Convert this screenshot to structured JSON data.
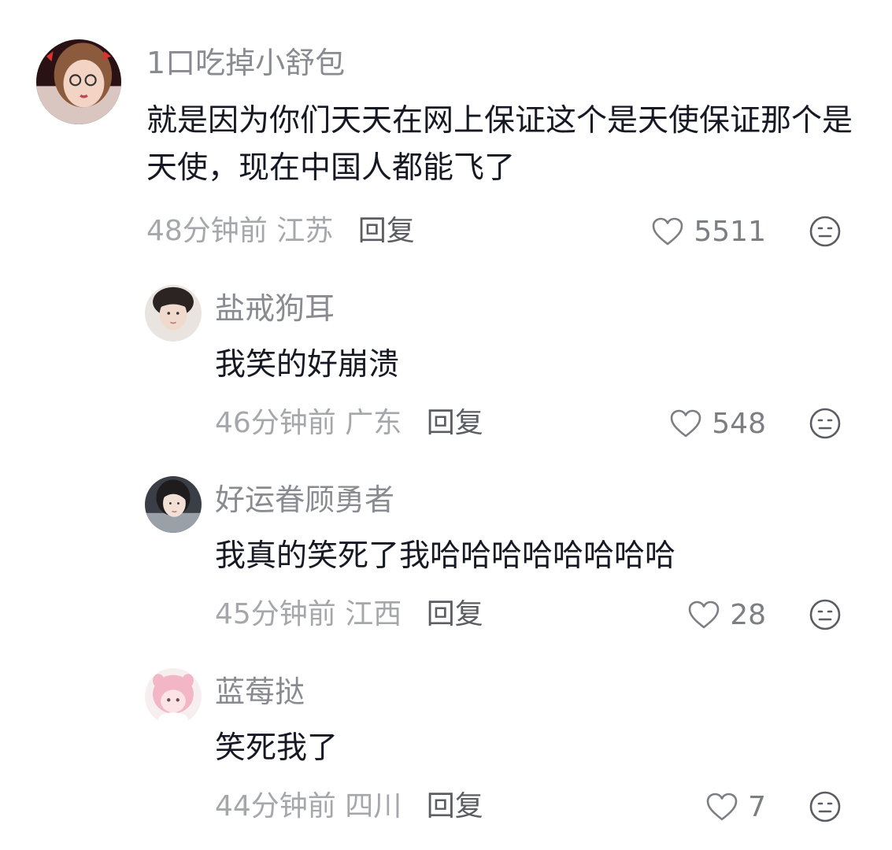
{
  "comment": {
    "username": "1口吃掉小舒包",
    "text": "就是因为你们天天在网上保证这个是天使保证那个是天使，现在中国人都能飞了",
    "time": "48分钟前",
    "location": "江苏",
    "reply_label": "回复",
    "likes": "5511",
    "avatar_icon": "avatar-photo"
  },
  "replies": [
    {
      "username": "盐戒狗耳",
      "text": "我笑的好崩溃",
      "time": "46分钟前",
      "location": "广东",
      "reply_label": "回复",
      "likes": "548",
      "avatar_icon": "avatar-photo"
    },
    {
      "username": "好运眷顾勇者",
      "text": "我真的笑死了我哈哈哈哈哈哈哈哈",
      "time": "45分钟前",
      "location": "江西",
      "reply_label": "回复",
      "likes": "28",
      "avatar_icon": "avatar-photo"
    },
    {
      "username": "蓝莓挞",
      "text": "笑死我了",
      "time": "44分钟前",
      "location": "四川",
      "reply_label": "回复",
      "likes": "7",
      "avatar_icon": "avatar-illustration"
    }
  ],
  "icons": {
    "like": "heart-outline-icon",
    "dislike": "neutral-face-icon"
  },
  "colors": {
    "username": "#8a8b91",
    "text": "#161823",
    "meta": "#a6a7ab",
    "reply": "#5c5d63",
    "icon": "#7d7e84"
  }
}
